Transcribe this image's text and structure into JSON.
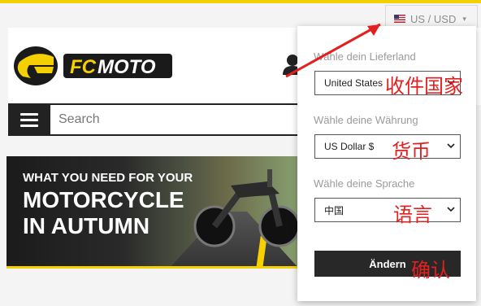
{
  "locale": {
    "label": "US / USD",
    "flag_icon": "us-flag-icon",
    "caret": "▾"
  },
  "search": {
    "placeholder": "Search"
  },
  "banner": {
    "line1": "WHAT YOU NEED FOR YOUR",
    "line2": "MOTORCYCLE",
    "line3": "IN AUTUMN"
  },
  "logo": {
    "text": "FC MOTO"
  },
  "panel": {
    "delivery_label": "Wähle dein Lieferland",
    "delivery_value": "United States",
    "currency_label": "Wähle deine Währung",
    "currency_value": "US Dollar $",
    "language_label": "Wähle deine Sprache",
    "language_value": "中国",
    "submit_label": "Ändern"
  },
  "annotations": {
    "delivery": "收件国家",
    "currency": "货币",
    "language": "语言",
    "confirm": "确认"
  },
  "colors": {
    "accent_yellow": "#f5d000",
    "annotation_red": "#e32020",
    "dark": "#222222"
  }
}
